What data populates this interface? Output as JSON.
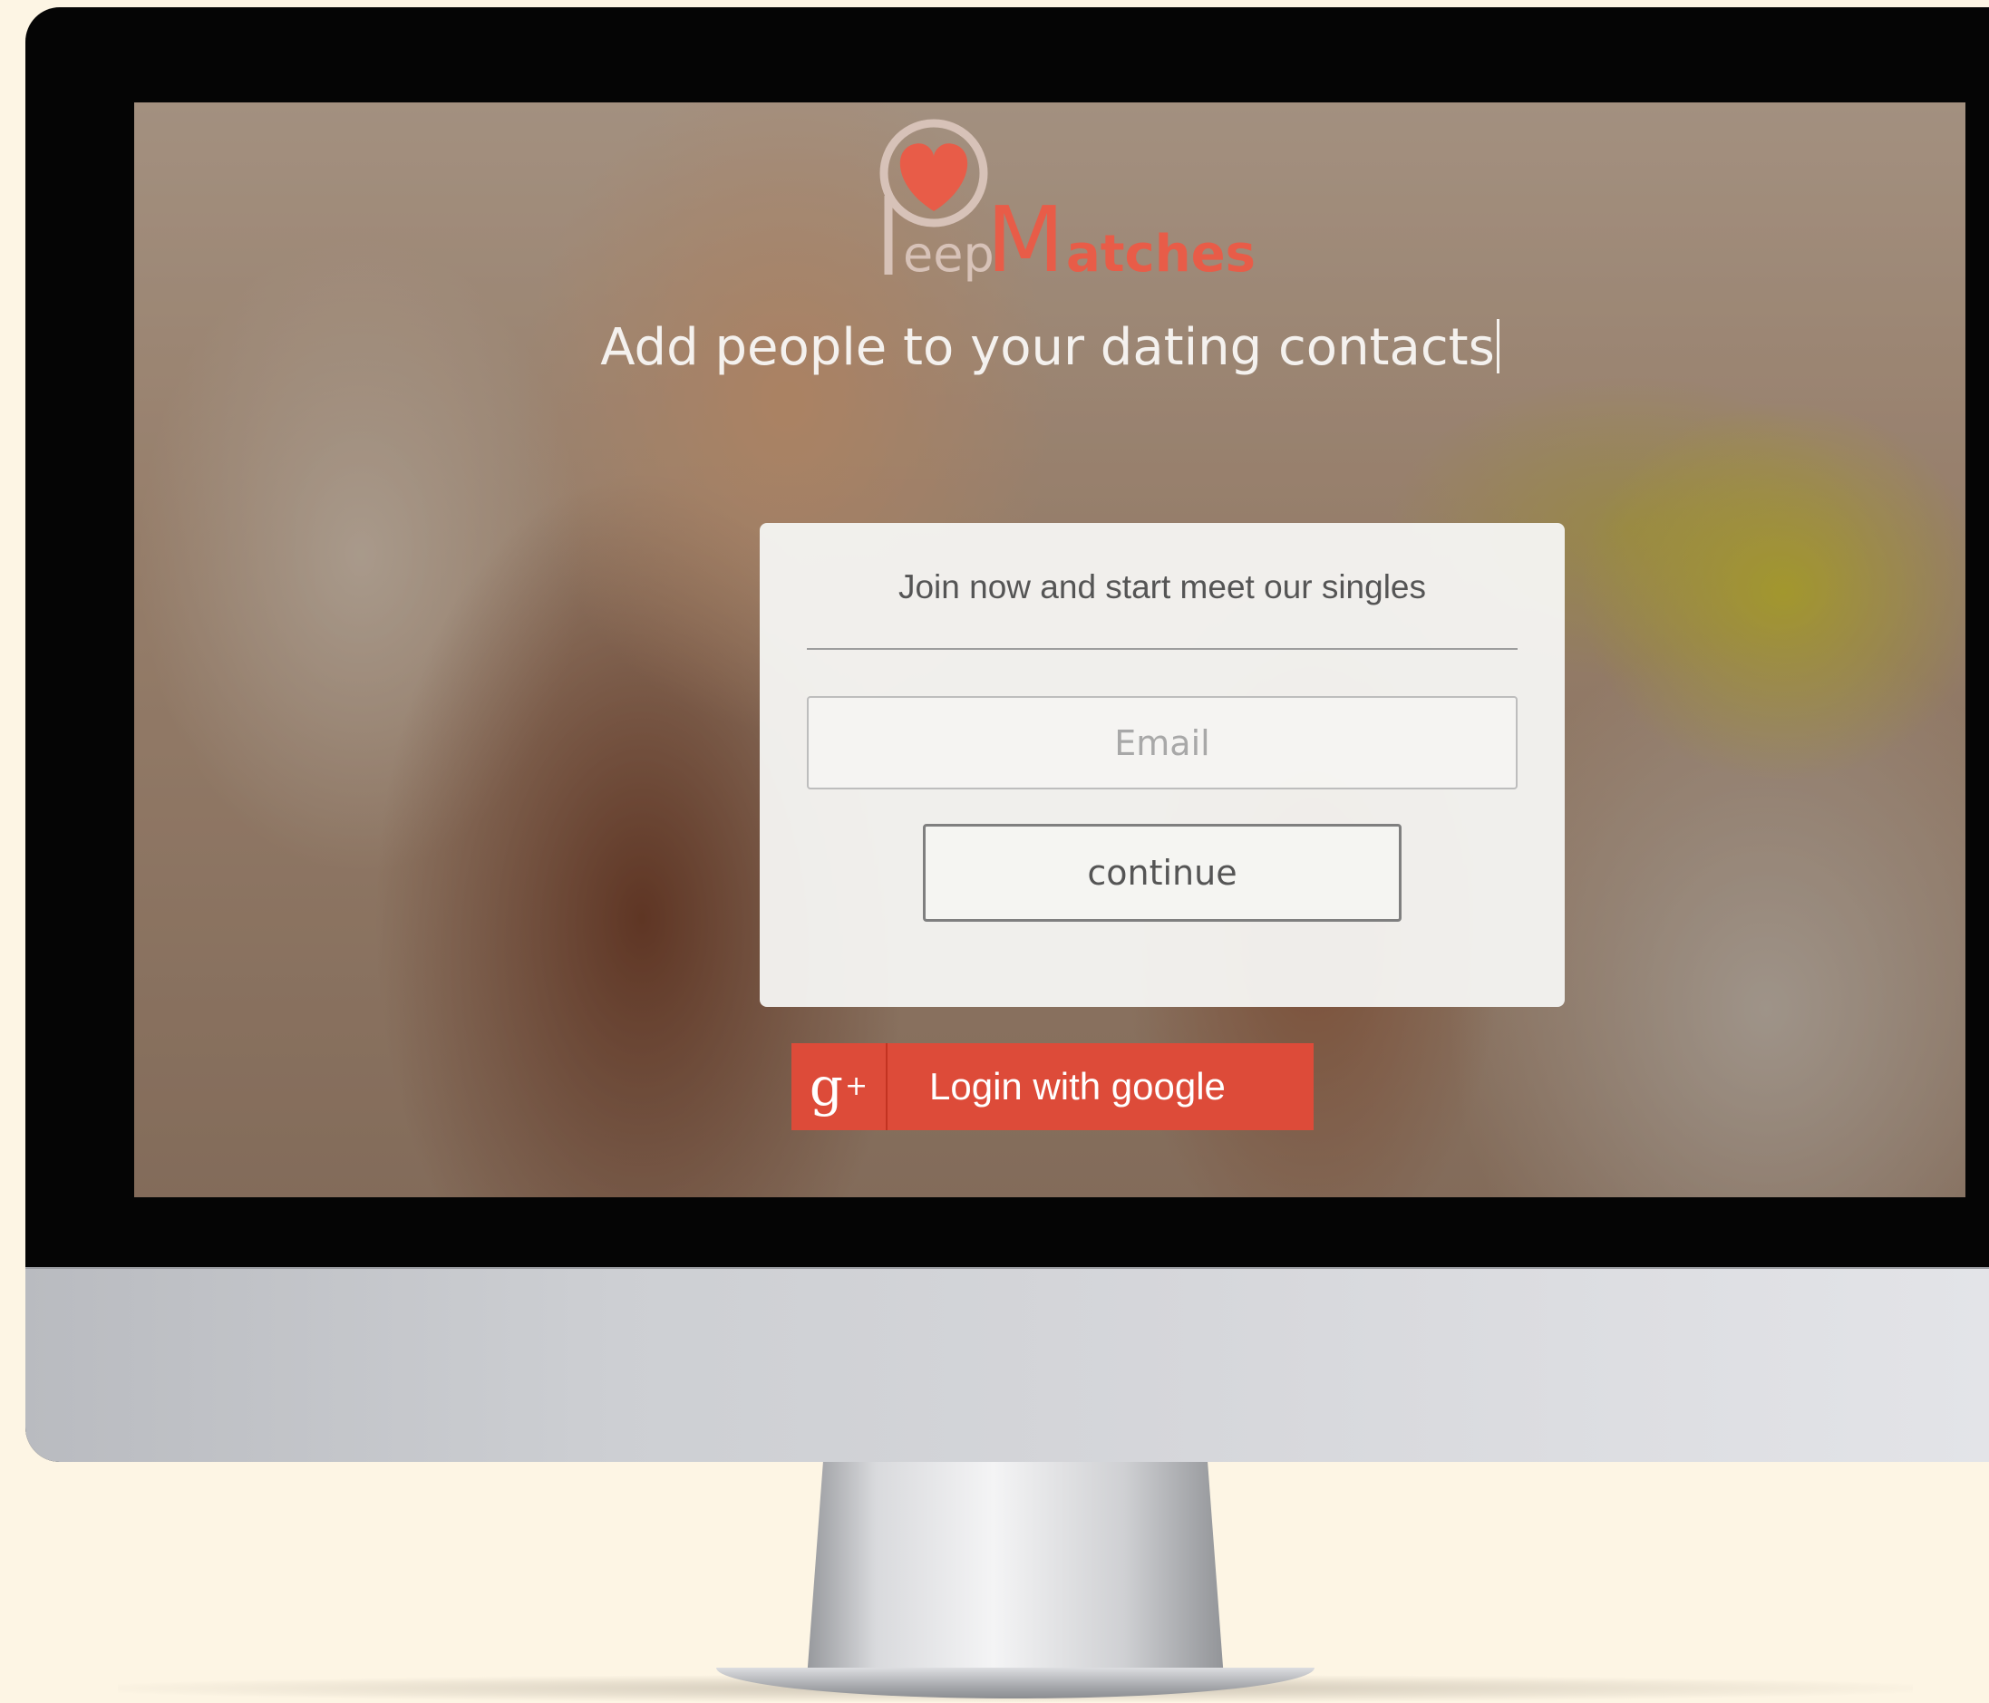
{
  "brand": {
    "logo_text_part1": "eep",
    "logo_text_part2": "Matches",
    "accent": "#e85c48"
  },
  "hero": {
    "headline": "Add people to your dating contacts"
  },
  "signup_card": {
    "title": "Join now and start meet our singles",
    "email_placeholder": "Email",
    "email_value": "",
    "continue_label": "continue"
  },
  "google_login": {
    "icon": "google-plus-icon",
    "icon_text": "g",
    "icon_sup": "+",
    "label": "Login with google",
    "color": "#dd4b39"
  }
}
